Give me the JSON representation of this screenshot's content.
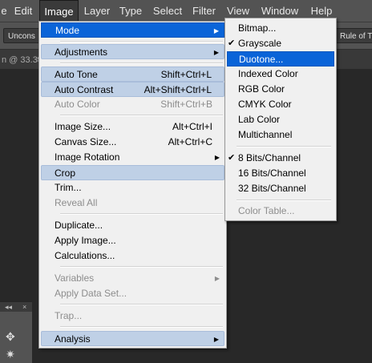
{
  "menubar": {
    "left_fragment": "e",
    "items": [
      "Edit",
      "Image",
      "Layer",
      "Type",
      "Select",
      "Filter",
      "View",
      "Window",
      "Help"
    ]
  },
  "options_bar": {
    "left_button": "Uncons",
    "right_button": "Rule of T"
  },
  "document_tab": {
    "label": "n @ 33.3%",
    "close": "×"
  },
  "image_menu": {
    "items": [
      {
        "label": "Mode",
        "shortcut": "",
        "submenu": true
      },
      {
        "label": "Adjustments",
        "shortcut": "",
        "submenu": true
      },
      {
        "label": "Auto Tone",
        "shortcut": "Shift+Ctrl+L"
      },
      {
        "label": "Auto Contrast",
        "shortcut": "Alt+Shift+Ctrl+L"
      },
      {
        "label": "Auto Color",
        "shortcut": "Shift+Ctrl+B"
      },
      {
        "label": "Image Size...",
        "shortcut": "Alt+Ctrl+I"
      },
      {
        "label": "Canvas Size...",
        "shortcut": "Alt+Ctrl+C"
      },
      {
        "label": "Image Rotation",
        "shortcut": "",
        "submenu": true
      },
      {
        "label": "Crop",
        "shortcut": ""
      },
      {
        "label": "Trim...",
        "shortcut": ""
      },
      {
        "label": "Reveal All",
        "shortcut": ""
      },
      {
        "label": "Duplicate...",
        "shortcut": ""
      },
      {
        "label": "Apply Image...",
        "shortcut": ""
      },
      {
        "label": "Calculations...",
        "shortcut": ""
      },
      {
        "label": "Variables",
        "shortcut": "",
        "submenu": true
      },
      {
        "label": "Apply Data Set...",
        "shortcut": ""
      },
      {
        "label": "Trap...",
        "shortcut": ""
      },
      {
        "label": "Analysis",
        "shortcut": "",
        "submenu": true
      }
    ]
  },
  "mode_submenu": {
    "items": [
      {
        "label": "Bitmap..."
      },
      {
        "label": "Grayscale",
        "checked": true
      },
      {
        "label": "Duotone..."
      },
      {
        "label": "Indexed Color"
      },
      {
        "label": "RGB Color"
      },
      {
        "label": "CMYK Color"
      },
      {
        "label": "Lab Color"
      },
      {
        "label": "Multichannel"
      },
      {
        "label": "8 Bits/Channel",
        "checked": true
      },
      {
        "label": "16 Bits/Channel"
      },
      {
        "label": "32 Bits/Channel"
      },
      {
        "label": "Color Table..."
      }
    ],
    "check_glyph": "✔"
  },
  "icons": {
    "submenu_arrow": "▶",
    "panel_grip": "◂◂",
    "panel_close": "×",
    "move_tool": "✥",
    "magic_wand_tool": "✷"
  },
  "colors": {
    "menu_bg": "#f0f0f0",
    "highlight": "#bfd0e6",
    "selected": "#0a64d8",
    "menubar_bg": "#535353"
  }
}
